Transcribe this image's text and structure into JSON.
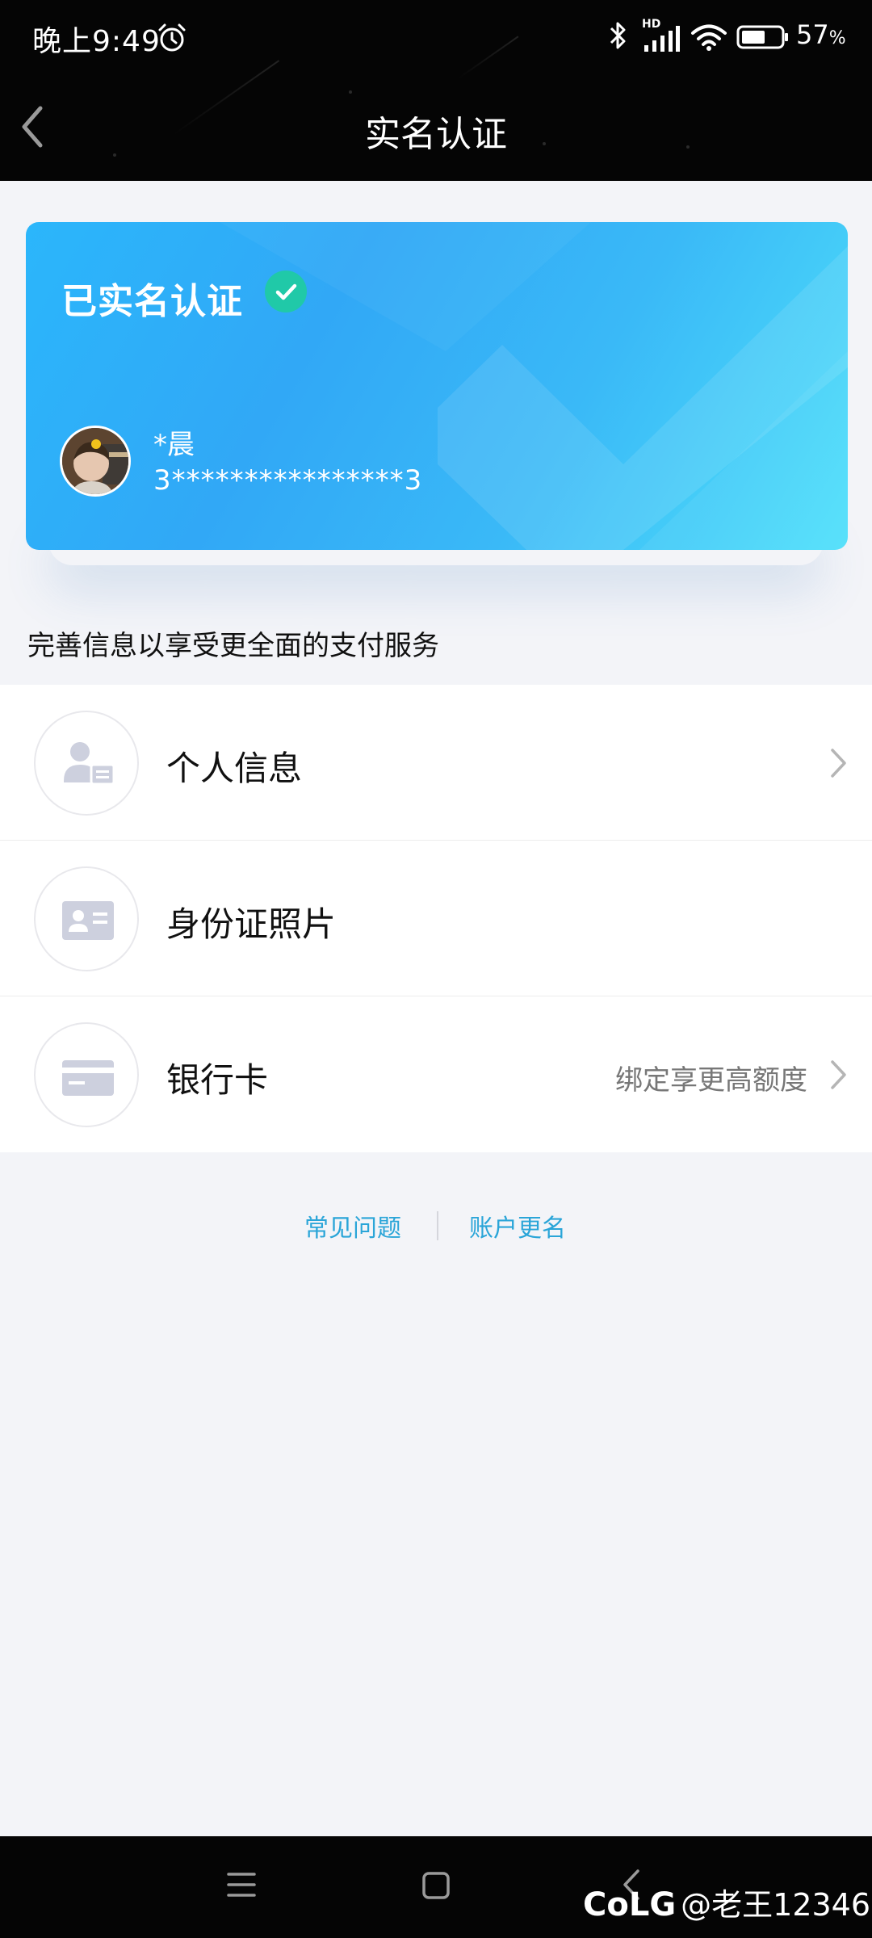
{
  "status_bar": {
    "time": "晚上9:49",
    "network_label": "HD",
    "battery_value": "57",
    "battery_unit": "%",
    "icons": [
      "alarm-icon",
      "bluetooth-icon",
      "signal-icon",
      "wifi-icon",
      "battery-icon"
    ]
  },
  "header": {
    "title": "实名认证",
    "back_icon": "back-arrow-icon"
  },
  "card": {
    "status_text": "已实名认证",
    "check_icon": "check-circle-icon",
    "name": "*晨",
    "id_number": "3****************3",
    "colors": {
      "gradient_start": "#2bb6fb",
      "gradient_end": "#4fe0fa",
      "check_bg": "#20c9a8"
    }
  },
  "hint_text": "完善信息以享受更全面的支付服务",
  "list": [
    {
      "label": "个人信息",
      "extra": "",
      "icon": "person-card-icon",
      "has_chevron": true
    },
    {
      "label": "身份证照片",
      "extra": "",
      "icon": "id-card-icon",
      "has_chevron": false
    },
    {
      "label": "银行卡",
      "extra": "绑定享更高额度",
      "icon": "bank-card-icon",
      "has_chevron": true
    }
  ],
  "links": {
    "faq": "常见问题",
    "rename": "账户更名",
    "color": "#2aa5d8"
  },
  "nav_bar": {
    "icons": [
      "menu-icon",
      "home-icon",
      "back-icon"
    ]
  },
  "watermark": {
    "brand": "CoLG",
    "handle": "@老王12346"
  }
}
